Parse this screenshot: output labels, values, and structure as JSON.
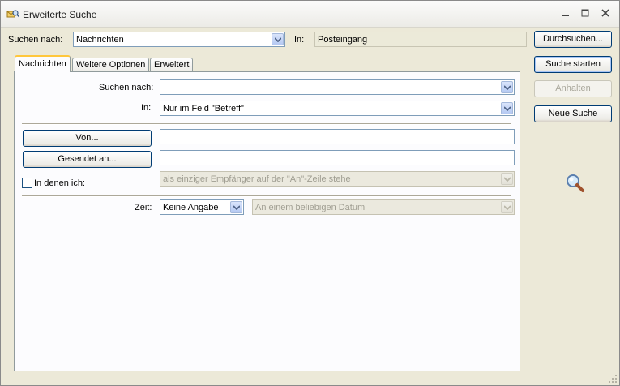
{
  "window": {
    "title": "Erweiterte Suche"
  },
  "top": {
    "search_for_label": "Suchen nach:",
    "search_for_value": "Nachrichten",
    "in_label": "In:",
    "in_value": "Posteingang",
    "browse_button": "Durchsuchen..."
  },
  "side_buttons": {
    "start": "Suche starten",
    "stop": "Anhalten",
    "new": "Neue Suche"
  },
  "tabs": [
    {
      "label": "Nachrichten",
      "active": true
    },
    {
      "label": "Weitere Optionen",
      "active": false
    },
    {
      "label": "Erweitert",
      "active": false
    }
  ],
  "messages_tab": {
    "search_for_label": "Suchen nach:",
    "search_for_value": "",
    "in_label": "In:",
    "in_value": "Nur im Feld \"Betreff\"",
    "from_button": "Von...",
    "from_value": "",
    "sent_to_button": "Gesendet an...",
    "sent_to_value": "",
    "where_i_am_label": "In denen ich:",
    "where_i_am_checked": false,
    "where_i_am_value": "als einziger Empfänger auf der \"An\"-Zeile stehe",
    "time_label": "Zeit:",
    "time_value": "Keine Angabe",
    "date_value": "An einem beliebigen Datum"
  }
}
